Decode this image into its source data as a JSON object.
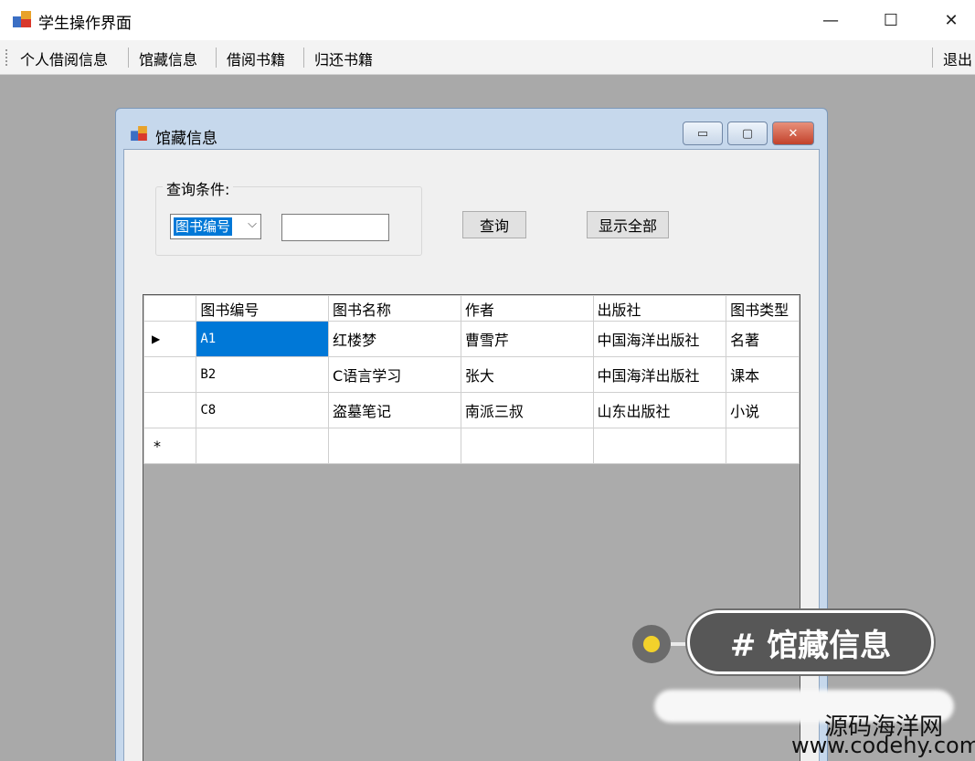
{
  "window": {
    "title": "学生操作界面"
  },
  "menu": {
    "items": [
      "个人借阅信息",
      "馆藏信息",
      "借阅书籍",
      "归还书籍"
    ],
    "exit": "退出"
  },
  "child": {
    "title": "馆藏信息"
  },
  "search": {
    "label": "查询条件:",
    "field_selected": "图书编号",
    "input_value": "",
    "query_button": "查询",
    "show_all_button": "显示全部"
  },
  "grid": {
    "columns": [
      "图书编号",
      "图书名称",
      "作者",
      "出版社",
      "图书类型"
    ],
    "rows": [
      [
        "A1",
        "红楼梦",
        "曹雪芹",
        "中国海洋出版社",
        "名著"
      ],
      [
        "B2",
        "C语言学习",
        "张大",
        "中国海洋出版社",
        "课本"
      ],
      [
        "C8",
        "盗墓笔记",
        "南派三叔",
        "山东出版社",
        "小说"
      ]
    ],
    "new_row_marker": "*",
    "current_row_marker": "▶"
  },
  "overlay": {
    "tag": "# 馆藏信息",
    "watermark_cn": "源码海洋网",
    "watermark_url": "www.codehy.com"
  },
  "colors": {
    "selection": "#0078d7",
    "mdi_background": "#a9a9a9",
    "tag_background": "#575757",
    "dot": "#f2d12b"
  }
}
